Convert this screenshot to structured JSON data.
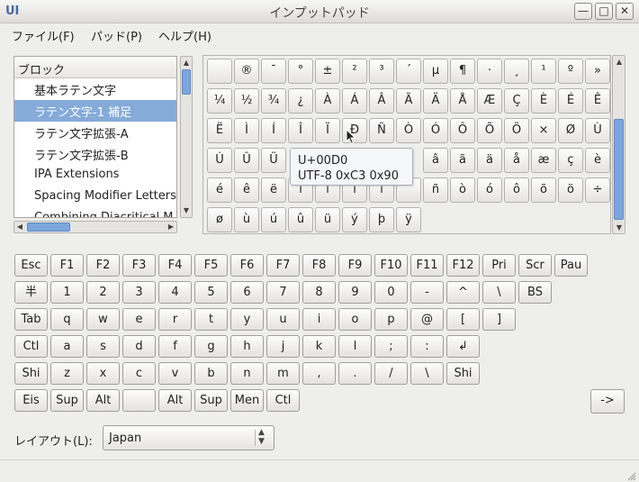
{
  "window": {
    "title": "インプットパッド",
    "app_icon_label": "UI",
    "minimize_glyph": "—",
    "maximize_glyph": "□",
    "close_glyph": "✕"
  },
  "menu": [
    {
      "label": "ファイル(F)"
    },
    {
      "label": "パッド(P)"
    },
    {
      "label": "ヘルプ(H)"
    }
  ],
  "blocks": {
    "header": "ブロック",
    "items": [
      {
        "label": "基本ラテン文字",
        "selected": false
      },
      {
        "label": "ラテン文字-1 補足",
        "selected": true
      },
      {
        "label": "ラテン文字拡張-A",
        "selected": false
      },
      {
        "label": "ラテン文字拡張-B",
        "selected": false
      },
      {
        "label": "IPA Extensions",
        "selected": false
      },
      {
        "label": "Spacing Modifier Letters",
        "selected": false
      },
      {
        "label": "Combining Diacritical M",
        "selected": false
      }
    ]
  },
  "chars": [
    [
      "",
      "®",
      "¯",
      "°",
      "±",
      "²",
      "³",
      "´",
      "µ",
      "¶",
      "·",
      "¸",
      "¹",
      "º",
      "»"
    ],
    [
      "¼",
      "½",
      "¾",
      "¿",
      "À",
      "Á",
      "Â",
      "Ã",
      "Ä",
      "Å",
      "Æ",
      "Ç",
      "È",
      "É",
      "Ê"
    ],
    [
      "Ë",
      "Ì",
      "Í",
      "Î",
      "Ï",
      "Ð",
      "Ñ",
      "Ò",
      "Ó",
      "Ô",
      "Õ",
      "Ö",
      "×",
      "Ø",
      "Ù"
    ],
    [
      "Ú",
      "Û",
      "Ü",
      "",
      "",
      "",
      "",
      "",
      "",
      "â",
      "ã",
      "ä",
      "å",
      "æ",
      "ç",
      "è"
    ],
    [
      "é",
      "ê",
      "ë",
      "ì",
      "í",
      "î",
      "ï",
      "",
      "ñ",
      "ò",
      "ó",
      "ô",
      "õ",
      "ö",
      "÷"
    ],
    [
      "ø",
      "ù",
      "ú",
      "û",
      "ü",
      "ý",
      "þ",
      "ÿ"
    ]
  ],
  "tooltip": {
    "line1": "U+00D0",
    "line2": "UTF-8 0xC3 0x90"
  },
  "keyboard": {
    "row1": [
      "Esc",
      "F1",
      "F2",
      "F3",
      "F4",
      "F5",
      "F6",
      "F7",
      "F8",
      "F9",
      "F10",
      "F11",
      "F12",
      "Pri",
      "Scr",
      "Pau"
    ],
    "row2": [
      "半",
      "1",
      "2",
      "3",
      "4",
      "5",
      "6",
      "7",
      "8",
      "9",
      "0",
      "-",
      "^",
      "\\",
      "BS"
    ],
    "row3": [
      "Tab",
      "q",
      "w",
      "e",
      "r",
      "t",
      "y",
      "u",
      "i",
      "o",
      "p",
      "@",
      "[",
      "]"
    ],
    "row4": [
      "Ctl",
      "a",
      "s",
      "d",
      "f",
      "g",
      "h",
      "j",
      "k",
      "l",
      ";",
      ":",
      "↲"
    ],
    "row5": [
      "Shi",
      "z",
      "x",
      "c",
      "v",
      "b",
      "n",
      "m",
      ",",
      ".",
      "/",
      "\\",
      "Shi"
    ],
    "row6": [
      "Eis",
      "Sup",
      "Alt",
      "",
      "Alt",
      "Sup",
      "Men",
      "Ctl"
    ],
    "arrow_button": "->"
  },
  "layout": {
    "label": "レイアウト(L):",
    "value": "Japan"
  },
  "colors": {
    "selection": "#86abd9",
    "scroll_thumb": "#7da6dc"
  }
}
